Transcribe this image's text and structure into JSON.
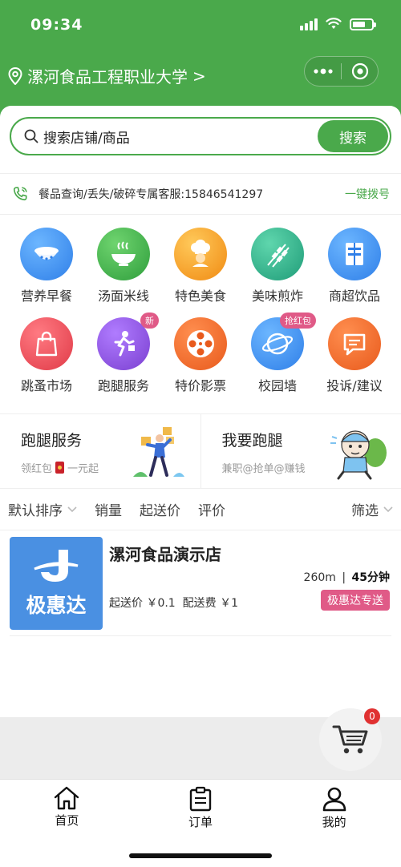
{
  "status_bar": {
    "time": "09:34"
  },
  "header": {
    "location": "漯河食品工程职业大学",
    "chevron": ">"
  },
  "search": {
    "placeholder": "搜索店铺/商品",
    "button_label": "搜索"
  },
  "hotline": {
    "text": "餐品查询/丢失/破碎专属客服:15846541297",
    "action_label": "一键拨号"
  },
  "categories": [
    {
      "label": "营养早餐",
      "icon": "breakfast-bowl-icon",
      "color": "#3b8ff3"
    },
    {
      "label": "汤面米线",
      "icon": "noodle-bowl-icon",
      "color": "#3fb44a"
    },
    {
      "label": "特色美食",
      "icon": "chef-icon",
      "color": "#f5a623"
    },
    {
      "label": "美味煎炸",
      "icon": "skewer-icon",
      "color": "#2db38a"
    },
    {
      "label": "商超饮品",
      "icon": "store-icon",
      "color": "#3b8ff3"
    },
    {
      "label": "跳蚤市场",
      "icon": "shopping-bag-icon",
      "color": "#e8454f"
    },
    {
      "label": "跑腿服务",
      "icon": "runner-icon",
      "color": "#8b4bd9",
      "badge": "新"
    },
    {
      "label": "特价影票",
      "icon": "film-reel-icon",
      "color": "#f06a2a"
    },
    {
      "label": "校园墙",
      "icon": "planet-icon",
      "color": "#3b8ff3",
      "badge": "抢红包"
    },
    {
      "label": "投诉/建议",
      "icon": "chat-bubble-icon",
      "color": "#f06a2a"
    }
  ],
  "promos": [
    {
      "title": "跑腿服务",
      "subtitle_left": "领红包",
      "subtitle_right": "一元起"
    },
    {
      "title": "我要跑腿",
      "subtitle": "兼职@抢单@赚钱"
    }
  ],
  "sort_bar": {
    "items": [
      "默认排序",
      "销量",
      "起送价",
      "评价"
    ],
    "filter": "筛选"
  },
  "store": {
    "logo_text": "极惠达",
    "name": "漯河食品演示店",
    "distance": "260m",
    "separator": "|",
    "delivery_time": "45分钟",
    "fees": "起送价 ￥0.1  配送费 ￥1",
    "tag": "极惠达专送"
  },
  "cart": {
    "count": "0"
  },
  "tabbar": {
    "items": [
      {
        "label": "首页",
        "icon": "home-icon"
      },
      {
        "label": "订单",
        "icon": "clipboard-icon"
      },
      {
        "label": "我的",
        "icon": "user-icon"
      }
    ]
  },
  "colors": {
    "brand_green": "#4aa94b",
    "tag_pink": "#e05a87",
    "logo_blue": "#4a90e2",
    "badge_red": "#e03131"
  }
}
